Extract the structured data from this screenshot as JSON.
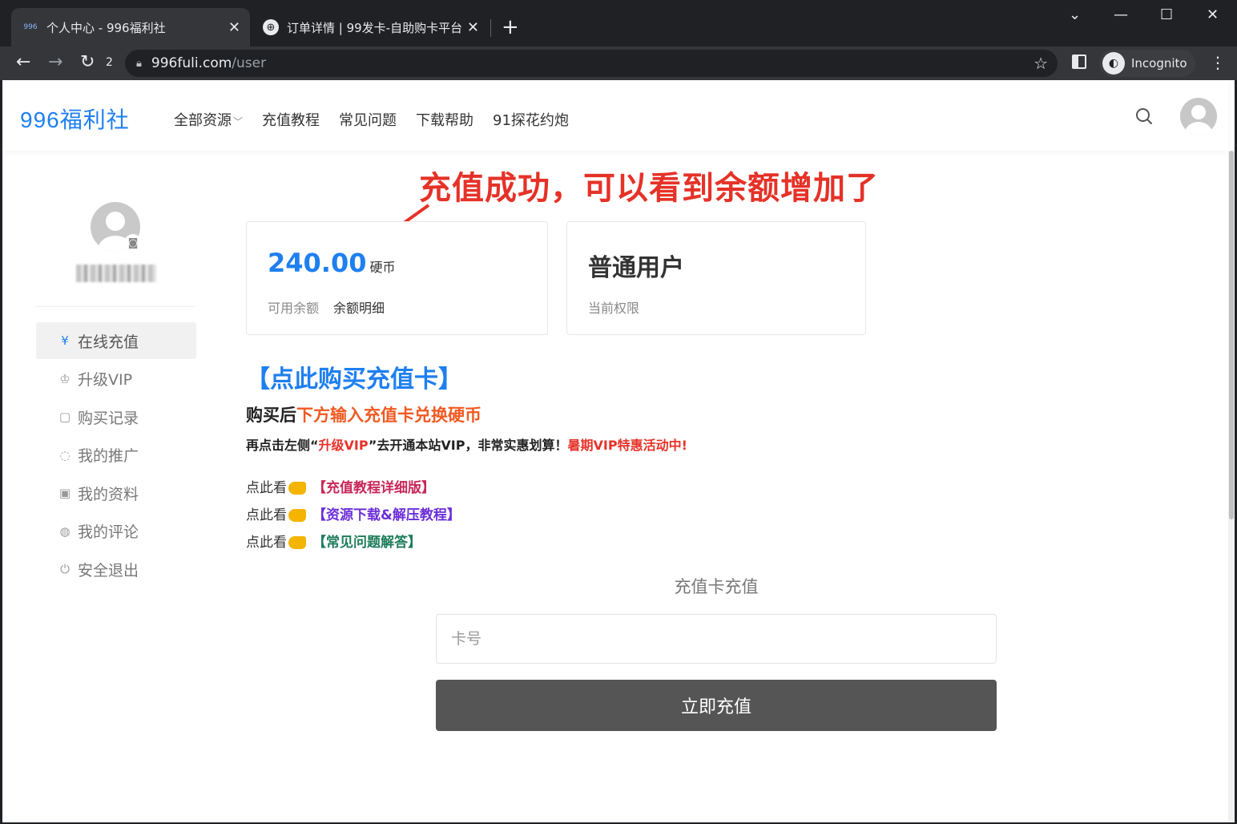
{
  "browser": {
    "tabs": [
      {
        "title": "个人中心 - 996福利社",
        "favicon": "996",
        "active": true
      },
      {
        "title": "订单详情 | 99发卡-自助购卡平台",
        "favicon": "globe-icon",
        "active": false
      }
    ],
    "reload_count": "2",
    "url_host": "996fuli.com",
    "url_path": "/user",
    "incognito_label": "Incognito"
  },
  "header": {
    "logo": "996福利社",
    "nav": [
      "全部资源",
      "充值教程",
      "常见问题",
      "下载帮助",
      "91探花约炮"
    ]
  },
  "annotation": "充值成功，可以看到余额增加了",
  "sidebar": {
    "items": [
      {
        "icon": "¥",
        "label": "在线充值"
      },
      {
        "icon": "♔",
        "label": "升级VIP"
      },
      {
        "icon": "▢",
        "label": "购买记录"
      },
      {
        "icon": "◌",
        "label": "我的推广"
      },
      {
        "icon": "▣",
        "label": "我的资料"
      },
      {
        "icon": "◍",
        "label": "我的评论"
      },
      {
        "icon": "⏻",
        "label": "安全退出"
      }
    ]
  },
  "balance": {
    "amount": "240.00",
    "unit": "硬币",
    "label": "可用余额",
    "detail_link": "余额明细"
  },
  "level": {
    "name": "普通用户",
    "label": "当前权限"
  },
  "promo": {
    "buy_link": "【点此购买充值卡】",
    "line1_a": "购买后",
    "line1_b": "下方输入充值卡兑换硬币",
    "line2_a": "再点击左侧“",
    "line2_b": "升级VIP",
    "line2_c": "”去开通本站VIP，非常实惠划算！",
    "line2_d": "暑期VIP特惠活动中!",
    "tutorials": [
      {
        "prefix": "点此看",
        "link": "【充值教程详细版】",
        "color": "#c8275a"
      },
      {
        "prefix": "点此看",
        "link": "【资源下载&解压教程】",
        "color": "#6c2fd8"
      },
      {
        "prefix": "点此看",
        "link": "【常见问题解答】",
        "color": "#1e7c5a"
      }
    ]
  },
  "recharge": {
    "title": "充值卡充值",
    "placeholder": "卡号",
    "button": "立即充值"
  },
  "colors": {
    "accent": "#1e7ff0",
    "annotation": "#e53228",
    "button": "#555555"
  }
}
